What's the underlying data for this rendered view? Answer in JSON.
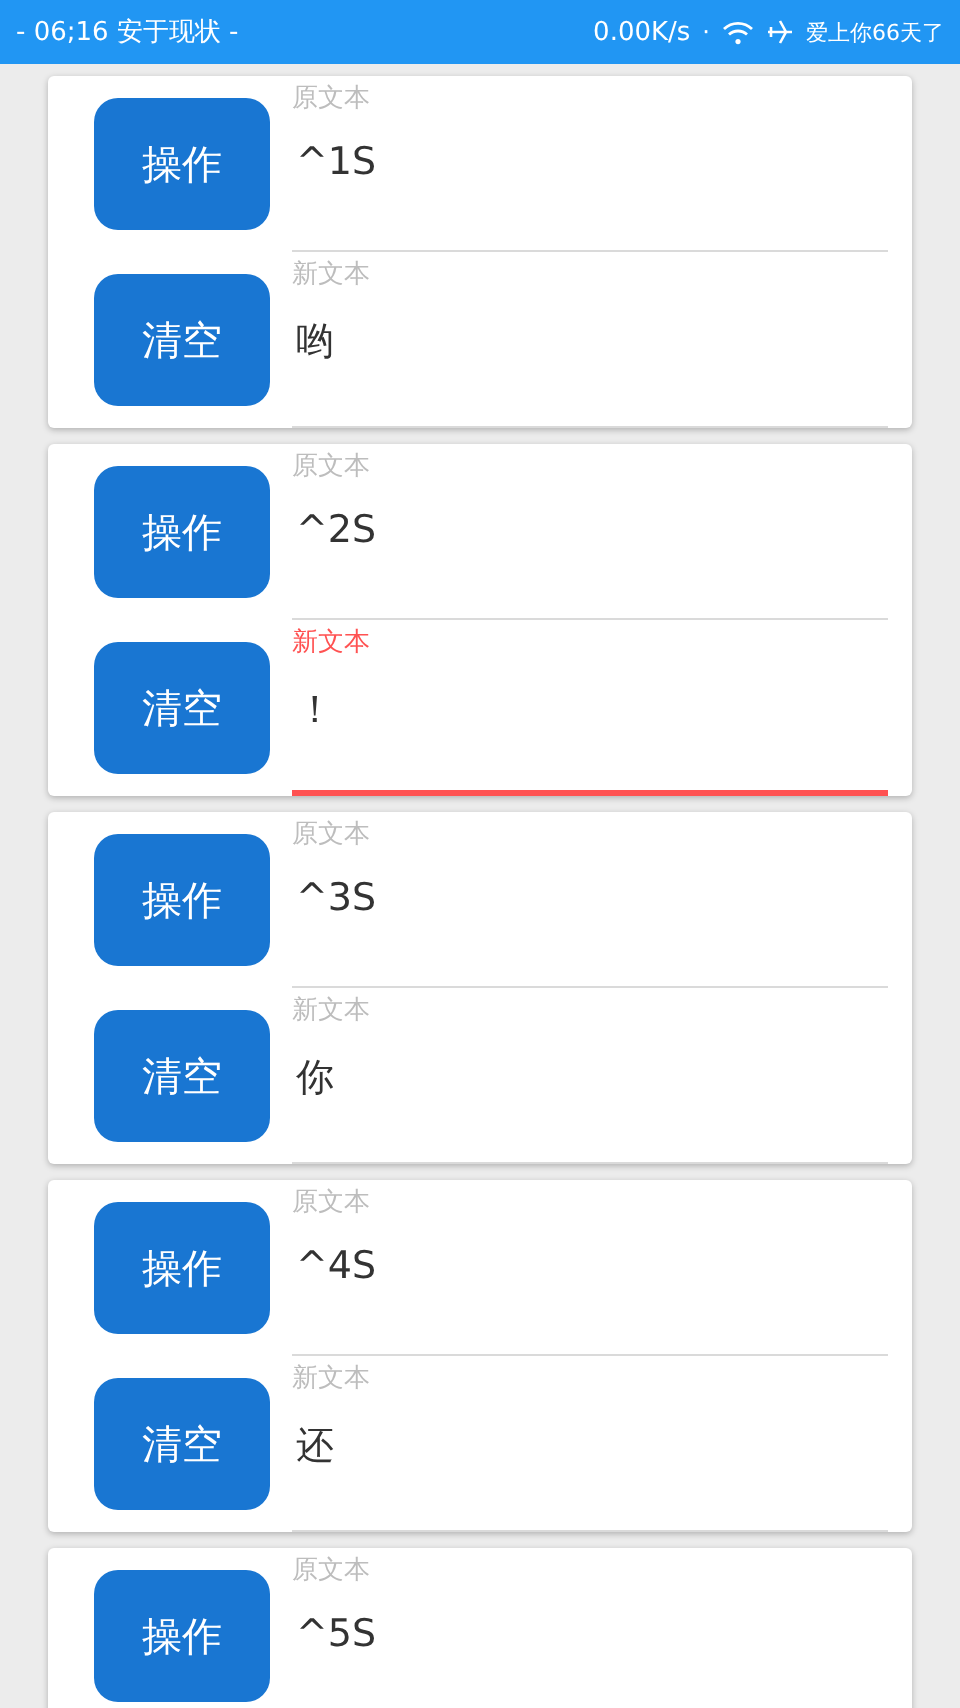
{
  "status_bar": {
    "left_text": "- 06;16  安于现状 -",
    "speed": "0.00K/s",
    "separator": "·",
    "right_text": "爱上你66天了"
  },
  "cards": [
    {
      "rows": [
        {
          "button": "操作",
          "label": "原文本",
          "value": "^1S",
          "focused": false
        },
        {
          "button": "清空",
          "label": "新文本",
          "value": "哟",
          "focused": false
        }
      ]
    },
    {
      "rows": [
        {
          "button": "操作",
          "label": "原文本",
          "value": "^2S",
          "focused": false
        },
        {
          "button": "清空",
          "label": "新文本",
          "value": "！",
          "focused": true
        }
      ]
    },
    {
      "rows": [
        {
          "button": "操作",
          "label": "原文本",
          "value": "^3S",
          "focused": false
        },
        {
          "button": "清空",
          "label": "新文本",
          "value": "你",
          "focused": false
        }
      ]
    },
    {
      "rows": [
        {
          "button": "操作",
          "label": "原文本",
          "value": "^4S",
          "focused": false
        },
        {
          "button": "清空",
          "label": "新文本",
          "value": "还",
          "focused": false
        }
      ]
    },
    {
      "rows": [
        {
          "button": "操作",
          "label": "原文本",
          "value": "^5S",
          "focused": false
        }
      ]
    }
  ]
}
